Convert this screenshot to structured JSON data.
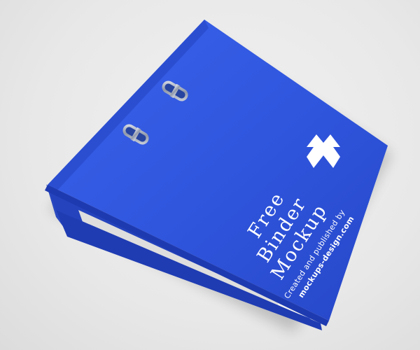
{
  "product": {
    "title_lines": [
      "Free",
      "Binder",
      "Mockup"
    ],
    "credit_lines": [
      "Created and published by",
      "mockups-design.com"
    ]
  },
  "colors": {
    "background": "#e9e9e9",
    "binder_blue": "#2f55dd",
    "binder_dark": "#1d3aa8",
    "paper": "#f4f4f4",
    "ring_metal": "#9aa3b3",
    "text": "#ffffff"
  },
  "icons": {
    "logo": "mockups-design-logo",
    "ring_holes": "binder-ring-icon"
  }
}
